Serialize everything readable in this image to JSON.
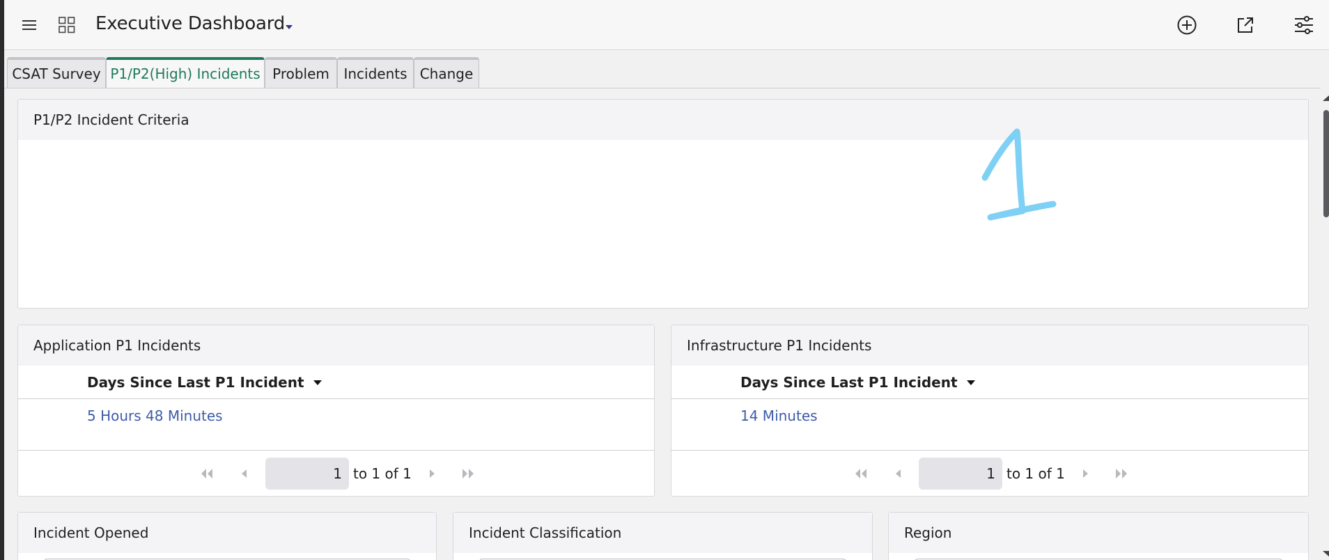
{
  "header": {
    "title": "Executive Dashboard",
    "icons": [
      "menu-icon",
      "apps-grid-icon",
      "chevron-down-icon",
      "add-circle-icon",
      "share-icon",
      "filter-sliders-icon"
    ]
  },
  "tabs": [
    {
      "label": "CSAT Survey",
      "active": false
    },
    {
      "label": "P1/P2(High) Incidents",
      "active": true
    },
    {
      "label": "Problem",
      "active": false
    },
    {
      "label": "Incidents",
      "active": false
    },
    {
      "label": "Change",
      "active": false
    }
  ],
  "colors": {
    "accent": "#1e7a5a",
    "link": "#3c5ba8",
    "annotation": "#7fd0f5"
  },
  "criteria_panel": {
    "title": "P1/P2 Incident Criteria",
    "annotation": "1"
  },
  "application_panel": {
    "title": "Application P1 Incidents",
    "column": "Days Since Last P1 Incident",
    "value": "5 Hours 48 Minutes",
    "page": "1",
    "range_text": "to 1 of 1"
  },
  "infrastructure_panel": {
    "title": "Infrastructure P1 Incidents",
    "column": "Days Since Last P1 Incident",
    "value": "14 Minutes",
    "page": "1",
    "range_text": "to 1 of 1"
  },
  "bottom_panels": {
    "incident_opened": "Incident Opened",
    "incident_classification": "Incident Classification",
    "region": "Region"
  }
}
